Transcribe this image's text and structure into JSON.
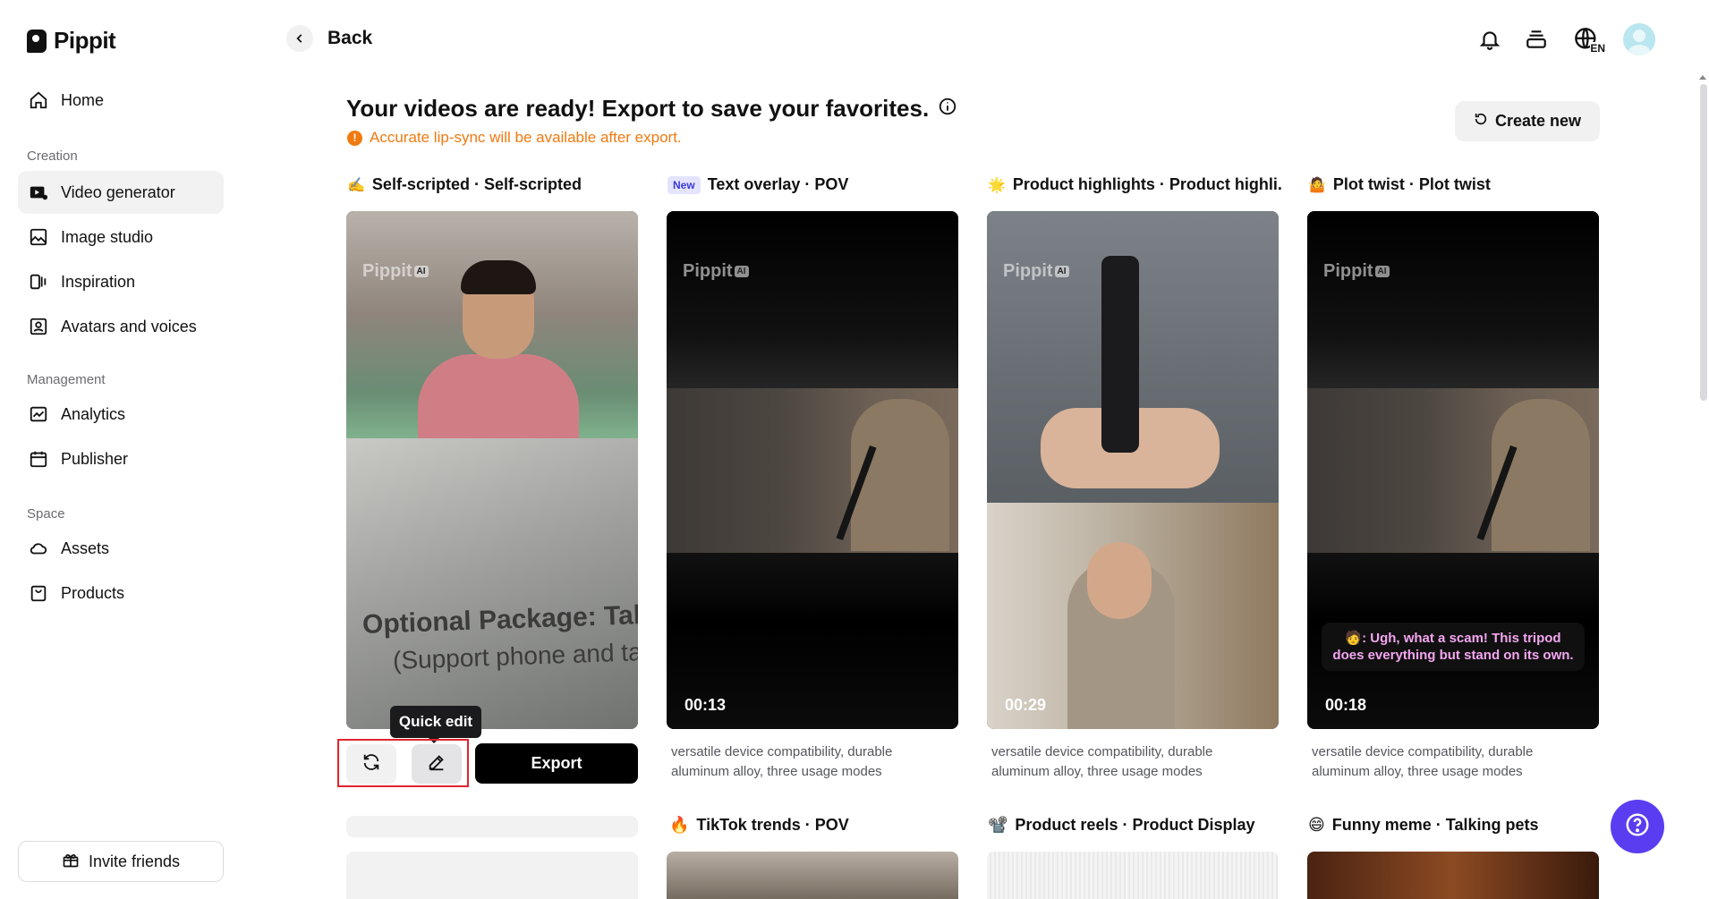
{
  "app": {
    "name": "Pippit"
  },
  "sidebar": {
    "items": [
      {
        "label": "Home",
        "icon": "home-icon"
      },
      {
        "label": "Video generator",
        "icon": "video-generator-icon",
        "active": true
      },
      {
        "label": "Image studio",
        "icon": "image-studio-icon"
      },
      {
        "label": "Inspiration",
        "icon": "inspiration-icon"
      },
      {
        "label": "Avatars and voices",
        "icon": "avatar-icon"
      },
      {
        "label": "Analytics",
        "icon": "analytics-icon"
      },
      {
        "label": "Publisher",
        "icon": "calendar-icon"
      },
      {
        "label": "Assets",
        "icon": "cloud-icon"
      },
      {
        "label": "Products",
        "icon": "product-icon"
      }
    ],
    "sections": {
      "creation": "Creation",
      "management": "Management",
      "space": "Space"
    },
    "invite_label": "Invite friends"
  },
  "header": {
    "back_label": "Back",
    "language_badge": "EN"
  },
  "main": {
    "headline": "Your videos are ready! Export to save your favorites.",
    "warning": "Accurate lip-sync will be available after export.",
    "create_new_label": "Create new",
    "cards": [
      {
        "emoji": "✍️",
        "title": "Self-scripted · Self-scripted",
        "badge": "",
        "duration": "",
        "description": ""
      },
      {
        "emoji": "",
        "title": "Text overlay · POV",
        "badge": "New",
        "duration": "00:13",
        "description": "versatile device compatibility, durable aluminum alloy, three usage modes"
      },
      {
        "emoji": "🌟",
        "title": "Product highlights · Product highli...",
        "badge": "",
        "duration": "00:29",
        "description": "versatile device compatibility, durable aluminum alloy, three usage modes"
      },
      {
        "emoji": "🤷",
        "title": "Plot twist · Plot twist",
        "badge": "",
        "duration": "00:18",
        "description": "versatile device compatibility, durable aluminum alloy, three usage modes",
        "caption": "🧑: Ugh, what a scam! This tripod does everything but stand on its own."
      }
    ],
    "watermark": "Pippit",
    "watermark_tag": "AI",
    "card1_overlay_line1": "Optional Package: Table",
    "card1_overlay_line2": "(Support phone and ta",
    "quick_edit_tooltip": "Quick edit",
    "export_label": "Export",
    "row2": [
      {
        "emoji": "🔥",
        "title": "TikTok trends · POV"
      },
      {
        "emoji": "📽️",
        "title": "Product reels · Product Display"
      },
      {
        "emoji": "😄",
        "title": "Funny meme · Talking pets"
      }
    ]
  },
  "colors": {
    "accent": "#5a3df0",
    "warning": "#f07a10",
    "highlight_frame": "#e0242e"
  }
}
